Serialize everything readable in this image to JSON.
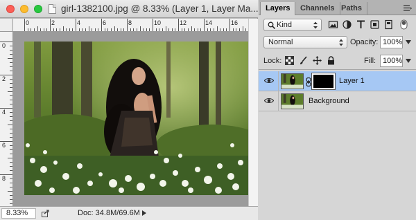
{
  "document": {
    "title": "girl-1382100.jpg @ 8.33% (Layer 1, Layer Ma...",
    "ruler_top_labels": [
      "0",
      "2",
      "4",
      "6",
      "8",
      "10",
      "12",
      "14",
      "16"
    ],
    "ruler_left_labels": [
      "0",
      "2",
      "4",
      "6",
      "8"
    ],
    "status": {
      "zoom": "8.33%",
      "doc_size": "Doc: 34.8M/69.6M"
    }
  },
  "panel": {
    "tabs": [
      {
        "label": "Layers",
        "active": true
      },
      {
        "label": "Channels",
        "active": false
      },
      {
        "label": "Paths",
        "active": false
      }
    ],
    "filter": {
      "kind_label": "Kind",
      "icons": [
        "image-filter-icon",
        "adjustment-filter-icon",
        "type-filter-icon",
        "shape-filter-icon",
        "smart-object-filter-icon"
      ]
    },
    "blend_mode": "Normal",
    "opacity_label": "Opacity:",
    "opacity_value": "100%",
    "lock_label": "Lock:",
    "fill_label": "Fill:",
    "fill_value": "100%",
    "layers": [
      {
        "name": "Layer 1",
        "selected": true,
        "has_mask": true,
        "visible": true
      },
      {
        "name": "Background",
        "selected": false,
        "has_mask": false,
        "visible": true
      }
    ]
  },
  "colors": {
    "selection": "#a6c8f4",
    "panel_bg": "#d6d6d6",
    "close": "#fc5f57",
    "minimize": "#fdbc2e",
    "zoom": "#28c840"
  }
}
